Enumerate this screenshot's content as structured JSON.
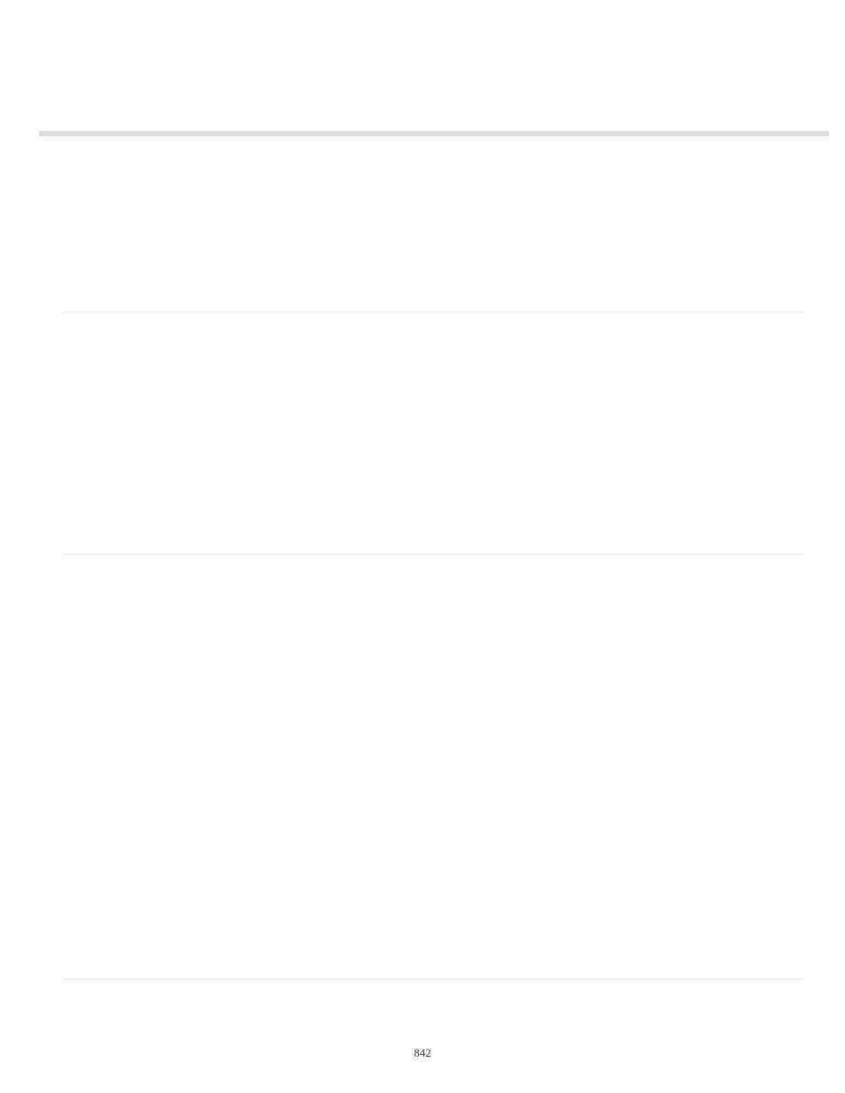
{
  "page_number": "842"
}
